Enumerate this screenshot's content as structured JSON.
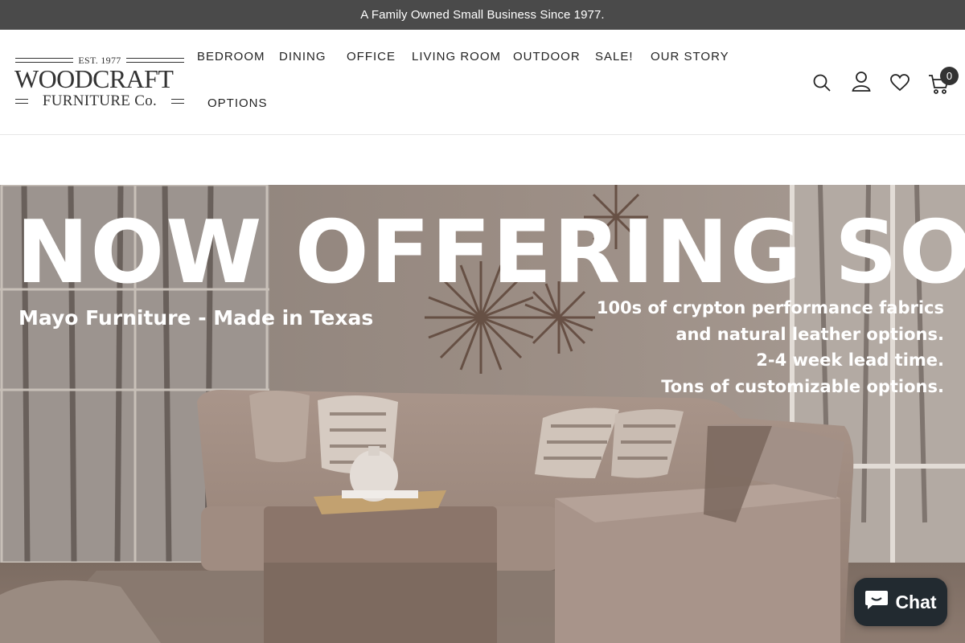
{
  "announcement": "A Family Owned Small Business Since 1977.",
  "logo": {
    "est": "EST. 1977",
    "brand": "WOODCRAFT",
    "sub": "FURNITURE Co."
  },
  "nav": [
    {
      "label": "BEDROOM"
    },
    {
      "label": "DINING"
    },
    {
      "label": "OFFICE"
    },
    {
      "label": "LIVING ROOM"
    },
    {
      "label": "OUTDOOR"
    },
    {
      "label": "SALE!"
    },
    {
      "label": "OUR STORY"
    },
    {
      "label": "OPTIONS"
    }
  ],
  "header_icons": [
    "search-icon",
    "account-icon",
    "wishlist-heart-icon",
    "cart-icon"
  ],
  "cart_count": "0",
  "hero": {
    "title": "NOW OFFERING SOFAS!",
    "subtitle": "Mayo Furniture - Made in Texas",
    "lines": [
      "100s of crypton performance fabrics",
      "and natural leather options.",
      "2-4 week lead time.",
      "Tons of customizable options."
    ]
  },
  "chat": {
    "label": "Chat"
  },
  "colors": {
    "announcement_bg": "#4a4a4a",
    "chat_bg": "#222a30",
    "hero_tone": "#8d8079"
  }
}
